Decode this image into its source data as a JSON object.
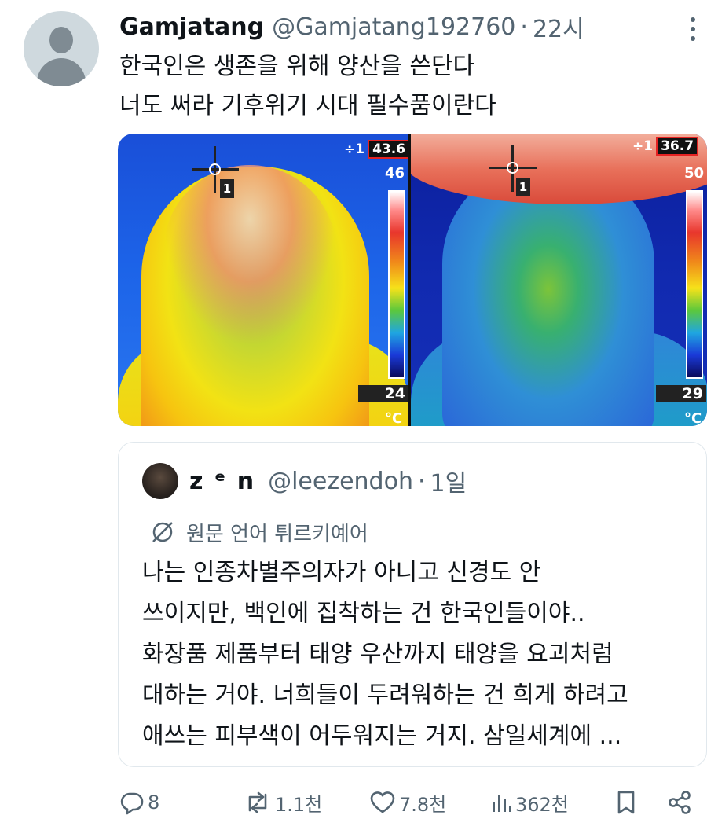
{
  "tweet": {
    "display_name": "Gamjatang",
    "handle": "@Gamjatang192760",
    "separator": "·",
    "time": "22시",
    "text_lines": [
      "한국인은 생존을 위해 양산을 쓴단다",
      "너도 써라 기후위기 시대 필수품이란다"
    ]
  },
  "media": {
    "left_image": {
      "spot_index": "1",
      "reading_prefix": "÷1",
      "reading": "43.6",
      "scale_max": "46",
      "scale_min": "24",
      "unit": "°C"
    },
    "right_image": {
      "spot_index": "1",
      "reading_prefix": "÷1",
      "reading": "36.7",
      "scale_max": "50",
      "scale_min": "29",
      "unit": "°C"
    }
  },
  "quote": {
    "display_name": "z ᵉ n",
    "handle": "@leezendoh",
    "separator": "·",
    "time": "1일",
    "translate_label": "원문 언어 튀르키예어",
    "text_lines": [
      "나는 인종차별주의자가 아니고 신경도 안",
      "쓰이지만, 백인에 집착하는 건 한국인들이야..",
      "화장품 제품부터 태양 우산까지 태양을 요괴처럼",
      "대하는 거야. 너희들이 두려워하는 건 희게 하려고",
      "애쓰는 피부색이 어두워지는 거지. 삼일세계에 ..."
    ]
  },
  "actions": {
    "replies": "8",
    "reposts": "1.1천",
    "likes": "7.8천",
    "views": "362천"
  },
  "icons": {
    "more": "more-vertical-icon",
    "reply": "reply-icon",
    "repost": "repost-icon",
    "like": "heart-icon",
    "views": "views-icon",
    "bookmark": "bookmark-icon",
    "share": "share-icon",
    "translate": "translate-icon"
  },
  "colors": {
    "text": "#0f1419",
    "muted": "#536471",
    "border": "#e1e8ed"
  }
}
